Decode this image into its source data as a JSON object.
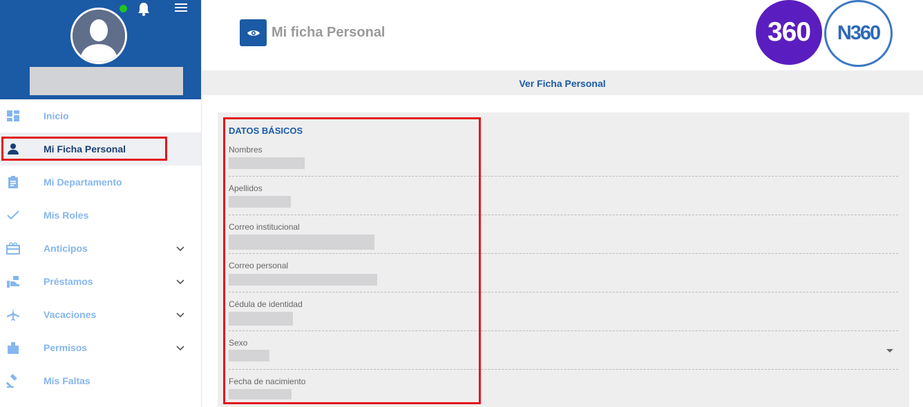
{
  "header": {
    "page_title": "Mi ficha Personal",
    "page_icon": "eye-icon",
    "logos": [
      {
        "name": "360-logo",
        "text": "360",
        "color": "#5a1ec0"
      },
      {
        "name": "n360-logo",
        "text": "N360",
        "color": "#2d6ab8"
      }
    ]
  },
  "user": {
    "status": "online",
    "status_color": "#22c322"
  },
  "sidebar": {
    "items": [
      {
        "label": "Inicio",
        "icon": "dashboard-icon",
        "active": false,
        "expandable": false
      },
      {
        "label": "Mi Ficha Personal",
        "icon": "person-icon",
        "active": true,
        "expandable": false
      },
      {
        "label": "Mi Departamento",
        "icon": "clipboard-icon",
        "active": false,
        "expandable": false
      },
      {
        "label": "Mis Roles",
        "icon": "check-icon",
        "active": false,
        "expandable": false
      },
      {
        "label": "Anticipos",
        "icon": "card-giftcard-icon",
        "active": false,
        "expandable": true
      },
      {
        "label": "Préstamos",
        "icon": "hand-money-icon",
        "active": false,
        "expandable": true
      },
      {
        "label": "Vacaciones",
        "icon": "airplane-icon",
        "active": false,
        "expandable": true
      },
      {
        "label": "Permisos",
        "icon": "folder-icon",
        "active": false,
        "expandable": true
      },
      {
        "label": "Mis Faltas",
        "icon": "gavel-icon",
        "active": false,
        "expandable": false
      }
    ]
  },
  "tab": {
    "label": "Ver Ficha Personal"
  },
  "card": {
    "section_title": "DATOS BÁSICOS",
    "fields": [
      {
        "label": "Nombres"
      },
      {
        "label": "Apellidos"
      },
      {
        "label": "Correo institucional"
      },
      {
        "label": "Correo personal"
      },
      {
        "label": "Cédula de identidad"
      },
      {
        "label": "Sexo"
      },
      {
        "label": "Fecha de nacimiento"
      }
    ]
  },
  "colors": {
    "primary": "#1b5aa5",
    "nav_label": "#86b6ef",
    "highlight": "#e2161c"
  }
}
